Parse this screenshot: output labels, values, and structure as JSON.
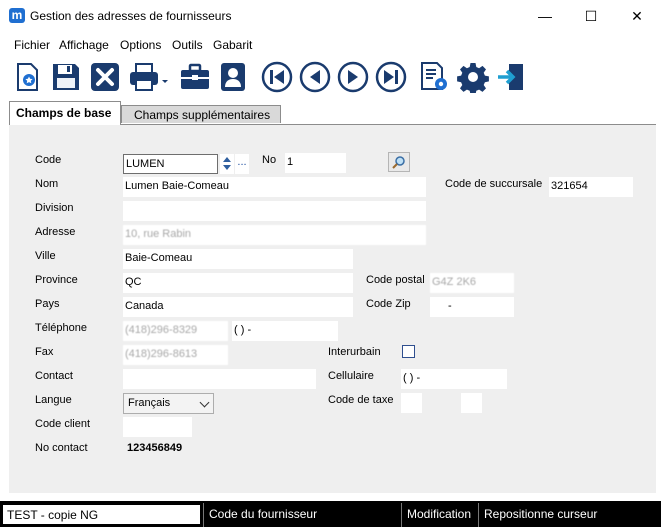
{
  "window": {
    "title": "Gestion des adresses de fournisseurs",
    "logo_letter": "m",
    "minimize_glyph": "—",
    "maximize_glyph": "☐",
    "close_glyph": "✕"
  },
  "menu": [
    "Fichier",
    "Affichage",
    "Options",
    "Outils",
    "Gabarit"
  ],
  "toolbar": [
    {
      "icon": "new-record-icon"
    },
    {
      "icon": "save-icon"
    },
    {
      "icon": "delete-icon"
    },
    {
      "icon": "print-icon"
    },
    {
      "icon": "briefcase-icon"
    },
    {
      "icon": "contact-card-icon"
    },
    {
      "icon": "first-record-icon"
    },
    {
      "icon": "previous-record-icon"
    },
    {
      "icon": "next-record-icon"
    },
    {
      "icon": "last-record-icon"
    },
    {
      "icon": "document-settings-icon"
    },
    {
      "icon": "settings-gear-icon"
    },
    {
      "icon": "exit-icon"
    }
  ],
  "tabs": [
    {
      "label": "Champs de base",
      "active": true
    },
    {
      "label": "Champs supplémentaires",
      "active": false
    }
  ],
  "form": {
    "code": {
      "label": "Code",
      "value": "LUMEN"
    },
    "no": {
      "label": "No",
      "value": "1"
    },
    "nom": {
      "label": "Nom",
      "value": "Lumen Baie-Comeau"
    },
    "code_succursale": {
      "label": "Code de succursale",
      "value": "321654"
    },
    "division": {
      "label": "Division",
      "value": ""
    },
    "adresse": {
      "label": "Adresse",
      "value": "10, rue Rabin"
    },
    "ville": {
      "label": "Ville",
      "value": "Baie-Comeau"
    },
    "province": {
      "label": "Province",
      "value": "QC"
    },
    "code_postal": {
      "label": "Code postal",
      "value": "G4Z 2K6"
    },
    "pays": {
      "label": "Pays",
      "value": "Canada"
    },
    "code_zip": {
      "label": "Code Zip",
      "value": "-"
    },
    "telephone": {
      "label": "Téléphone",
      "value": "(418)296-8329",
      "value2": "(  )  -"
    },
    "fax": {
      "label": "Fax",
      "value": "(418)296-8613"
    },
    "interurbain": {
      "label": "Interurbain"
    },
    "contact": {
      "label": "Contact",
      "value": ""
    },
    "cellulaire": {
      "label": "Cellulaire",
      "value": "(  )  -"
    },
    "langue": {
      "label": "Langue",
      "value": "Français"
    },
    "code_taxe": {
      "label": "Code de taxe",
      "value": ""
    },
    "code_client": {
      "label": "Code client",
      "value": ""
    },
    "no_contact": {
      "label": "No contact",
      "value": "123456849"
    },
    "ellipsis": "..."
  },
  "status": {
    "db": "TEST - copie NG",
    "field": "Code du fournisseur",
    "mode": "Modification",
    "hint": "Repositionne curseur"
  },
  "colors": {
    "accent": "#1f6fd1",
    "nav_blue": "#1f4fa0"
  }
}
